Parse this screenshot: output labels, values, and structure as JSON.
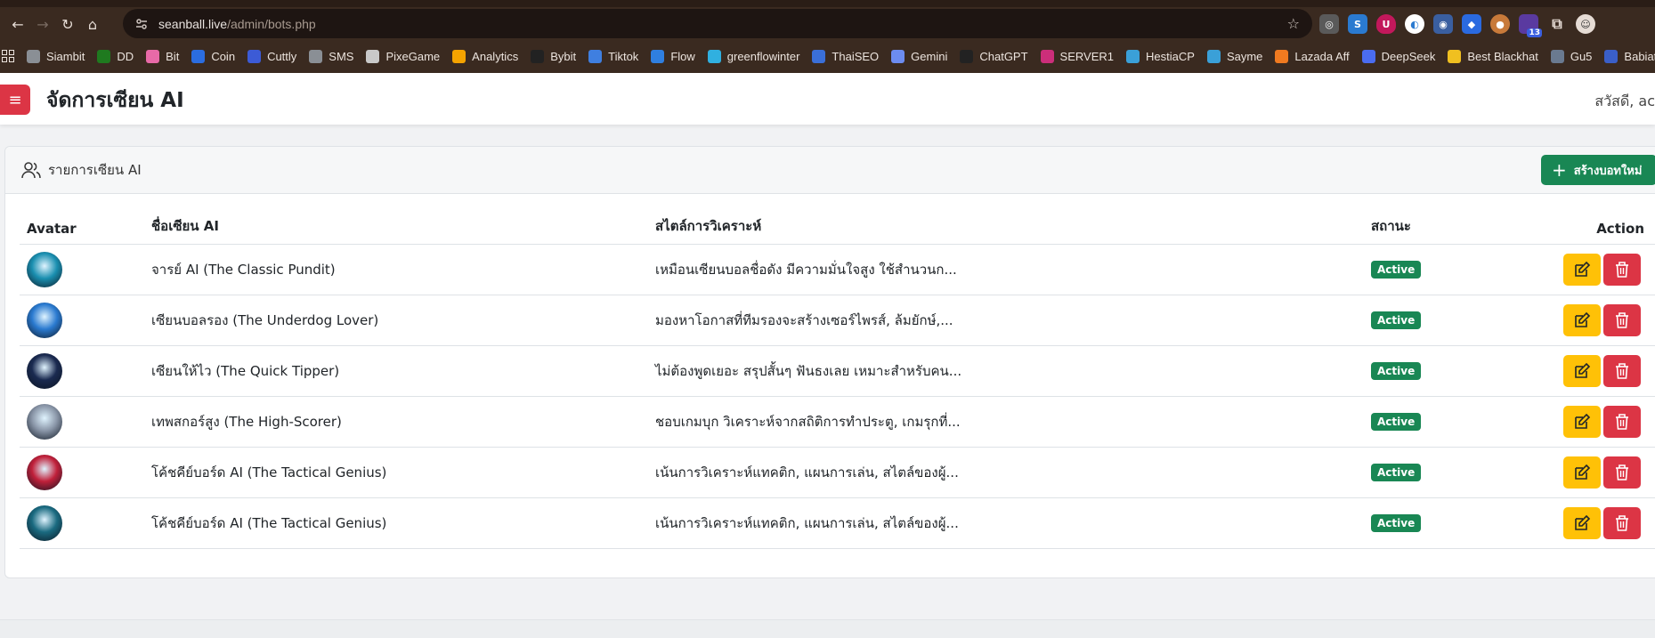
{
  "browser": {
    "url_host": "seanball.live",
    "url_path": "/admin/bots.php",
    "extension_badge": "13",
    "bookmarks": [
      {
        "label": "Siambit",
        "color": "#8a8f95"
      },
      {
        "label": "DD",
        "color": "#1f7a1f"
      },
      {
        "label": "Bit",
        "color": "#e86aa8"
      },
      {
        "label": "Coin",
        "color": "#2b6de0"
      },
      {
        "label": "Cuttly",
        "color": "#3c5bd6"
      },
      {
        "label": "SMS",
        "color": "#8a8f95"
      },
      {
        "label": "PixeGame",
        "color": "#c9c9c9"
      },
      {
        "label": "Analytics",
        "color": "#f4a300"
      },
      {
        "label": "Bybit",
        "color": "#222222"
      },
      {
        "label": "Tiktok",
        "color": "#3f7fe0"
      },
      {
        "label": "Flow",
        "color": "#2f7fe0"
      },
      {
        "label": "greenflowinter",
        "color": "#30b0e0"
      },
      {
        "label": "ThaiSEO",
        "color": "#3a6fd8"
      },
      {
        "label": "Gemini",
        "color": "#6c8cf0"
      },
      {
        "label": "ChatGPT",
        "color": "#222222"
      },
      {
        "label": "SERVER1",
        "color": "#cc2e7a"
      },
      {
        "label": "HestiaCP",
        "color": "#3aa0d8"
      },
      {
        "label": "Sayme",
        "color": "#3aa0d8"
      },
      {
        "label": "Lazada Aff",
        "color": "#f07a20"
      },
      {
        "label": "DeepSeek",
        "color": "#4a6cf0"
      },
      {
        "label": "Best Blackhat",
        "color": "#f0c020"
      },
      {
        "label": "Gu5",
        "color": "#6a7a90"
      },
      {
        "label": "Babiato",
        "color": "#3a5fc8"
      }
    ]
  },
  "header": {
    "title": "จัดการเซียน AI",
    "greeting": "สวัสดี, ac"
  },
  "card": {
    "title": "รายการเซียน AI",
    "new_button": "สร้างบอทใหม่"
  },
  "table": {
    "columns": {
      "avatar": "Avatar",
      "name": "ชื่อเซียน AI",
      "style": "สไตล์การวิเคราะห์",
      "status": "สถานะ",
      "action": "Action"
    },
    "rows": [
      {
        "name": "จารย์ AI (The Classic Pundit)",
        "style": "เหมือนเซียนบอลชื่อดัง มีความมั่นใจสูง ใช้สำนวนก...",
        "status": "Active",
        "avatar_color": "#1a8fb0"
      },
      {
        "name": "เซียนบอลรอง (The Underdog Lover)",
        "style": "มองหาโอกาสที่ทีมรองจะสร้างเซอร์ไพรส์, ล้มยักษ์,...",
        "status": "Active",
        "avatar_color": "#2a7ad0"
      },
      {
        "name": "เซียนให้ไว (The Quick Tipper)",
        "style": "ไม่ต้องพูดเยอะ สรุปสั้นๆ ฟันธงเลย เหมาะสำหรับคน...",
        "status": "Active",
        "avatar_color": "#1a2a50"
      },
      {
        "name": "เทพสกอร์สูง (The High-Scorer)",
        "style": "ชอบเกมบุก วิเคราะห์จากสถิติการทำประตู, เกมรุกที่...",
        "status": "Active",
        "avatar_color": "#8a96a8"
      },
      {
        "name": "โค้ชคีย์บอร์ด AI (The Tactical Genius)",
        "style": "เน้นการวิเคราะห์แทคติก, แผนการเล่น, สไตล์ของผู้...",
        "status": "Active",
        "avatar_color": "#c0203a"
      },
      {
        "name": "โค้ชคีย์บอร์ด AI (The Tactical Genius)",
        "style": "เน้นการวิเคราะห์แทคติก, แผนการเล่น, สไตล์ของผู้...",
        "status": "Active",
        "avatar_color": "#1a6a80"
      }
    ]
  }
}
